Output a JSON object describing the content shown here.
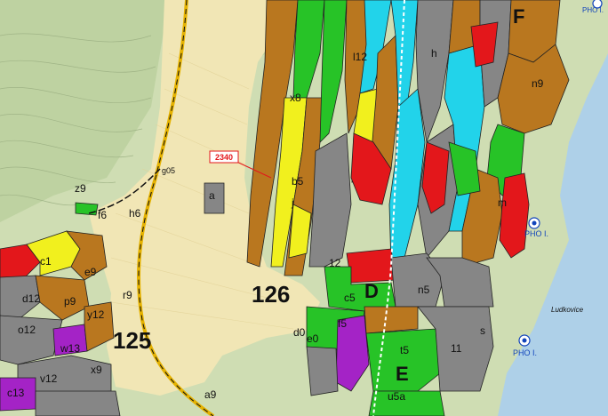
{
  "map": {
    "compartments": [
      "125",
      "126"
    ],
    "district_letters": [
      "D",
      "E",
      "F"
    ],
    "callout": "2340",
    "place_name": "Ludkovice",
    "pho_label": "PHO I.",
    "colors": {
      "forest_light": "#cfddb3",
      "meadow": "#f1e6b5",
      "lake": "#aed0e8",
      "green": "#27c327",
      "brown": "#b9771f",
      "gray": "#868686",
      "cyan": "#22d3ea",
      "yellow": "#f1f01e",
      "red": "#e3171b",
      "purple": "#a423c6",
      "road": "#e5b200"
    },
    "stand_labels": {
      "c1": "c1",
      "d12": "d12",
      "e9": "e9",
      "f6": "f6",
      "h6": "h6",
      "z9": "z9",
      "g05": "g05",
      "p9": "p9",
      "y12": "y12",
      "o12": "o12",
      "r9": "r9",
      "w13": "w13",
      "x9": "x9",
      "v12": "v12",
      "c13": "c13",
      "a9": "a9",
      "a": "a",
      "d0": "d0",
      "e0": "e0",
      "f5": "f5",
      "c5": "c5",
      "b5": "b5",
      "n5": "n5",
      "t5": "t5",
      "u5a": "u5a",
      "s": "s",
      "m": "m",
      "n9": "n9",
      "11": "11",
      "12": "12",
      "x8": "x8",
      "l12": "l12",
      "j": "j",
      "h": "h"
    }
  }
}
